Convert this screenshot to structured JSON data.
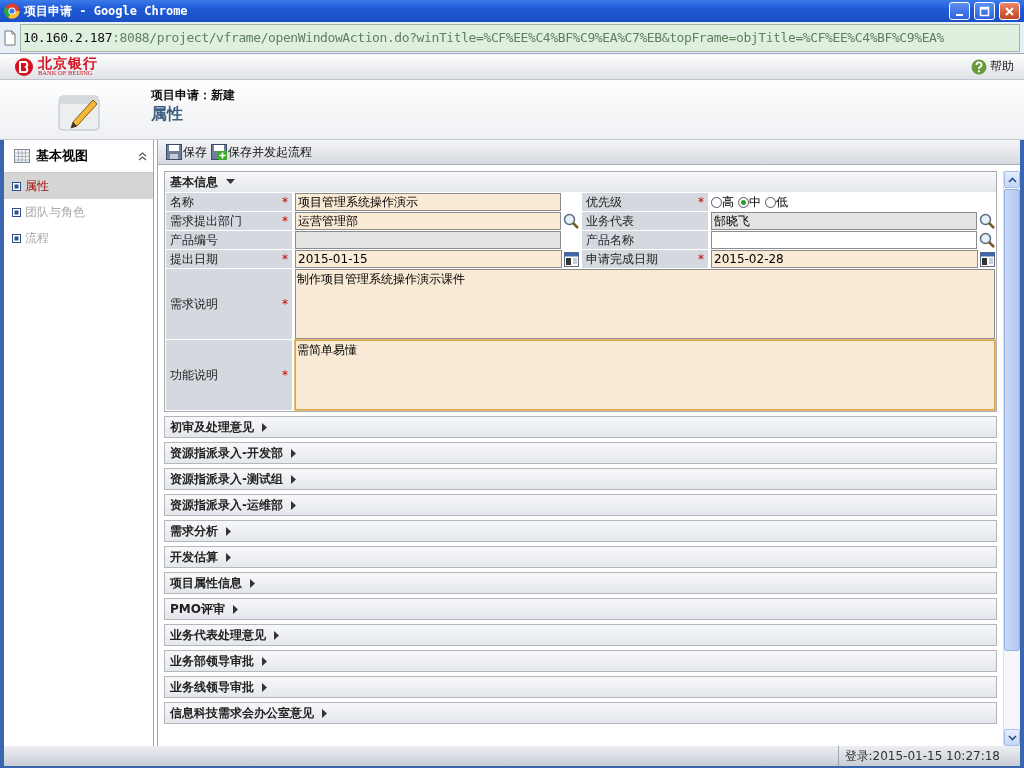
{
  "window": {
    "title": "项目申请 - Google Chrome"
  },
  "address": {
    "host": "10.160.2.187",
    "rest": ":8088/project/vframe/openWindowAction.do?winTitle=%CF%EE%C4%BF%C9%EA%C7%EB&topFrame=objTitle=%CF%EE%C4%BF%C9%EA%"
  },
  "brand": {
    "name": "北京银行",
    "subtitle": "BANK OF BEIJING",
    "help": "帮助"
  },
  "page_header": {
    "title": "项目申请：新建",
    "subtitle": "属性"
  },
  "sidebar": {
    "title": "基本视图",
    "items": [
      {
        "label": "属性",
        "selected": true,
        "disabled": false
      },
      {
        "label": "团队与角色",
        "selected": false,
        "disabled": true
      },
      {
        "label": "流程",
        "selected": false,
        "disabled": true
      }
    ]
  },
  "toolbar": [
    {
      "kind": "save",
      "label": "保存"
    },
    {
      "kind": "save-start",
      "label": "保存并发起流程"
    }
  ],
  "sections": [
    {
      "title": "基本信息",
      "expanded": true,
      "fields": [
        {
          "kind": "text",
          "label": "名称",
          "required_mark": "*",
          "readonly": false,
          "value": "项目管理系统操作演示"
        },
        {
          "kind": "radio",
          "label": "优先级",
          "required_mark": "*",
          "options": [
            {
              "label": "高",
              "selected": false
            },
            {
              "label": "中",
              "selected": true
            },
            {
              "label": "低",
              "selected": false
            }
          ]
        },
        {
          "kind": "lookup",
          "label": "需求提出部门",
          "required_mark": "*",
          "readonly": false,
          "value": "运营管理部"
        },
        {
          "kind": "lookup",
          "label": "业务代表",
          "readonly": true,
          "value": "郜晓飞"
        },
        {
          "kind": "text",
          "label": "产品编号",
          "readonly": true
        },
        {
          "kind": "lookup",
          "label": "产品名称",
          "readonly": false
        },
        {
          "kind": "date",
          "label": "提出日期",
          "required_mark": "*",
          "readonly": false,
          "value": "2015-01-15"
        },
        {
          "kind": "date",
          "label": "申请完成日期",
          "required_mark": "*",
          "readonly": false,
          "value": "2015-02-28"
        },
        {
          "kind": "textarea",
          "label": "需求说明",
          "required_mark": "*",
          "focused": false,
          "value": "制作项目管理系统操作演示课件"
        },
        {
          "kind": "textarea",
          "label": "功能说明",
          "required_mark": "*",
          "focused": true,
          "value": "需简单易懂"
        }
      ]
    },
    {
      "title": "初审及处理意见",
      "expanded": false
    },
    {
      "title": "资源指派录入-开发部",
      "expanded": false
    },
    {
      "title": "资源指派录入-测试组",
      "expanded": false
    },
    {
      "title": "资源指派录入-运维部",
      "expanded": false
    },
    {
      "title": "需求分析",
      "expanded": false
    },
    {
      "title": "开发估算",
      "expanded": false
    },
    {
      "title": "项目属性信息",
      "expanded": false
    },
    {
      "title": "PMO评审",
      "expanded": false
    },
    {
      "title": "业务代表处理意见",
      "expanded": false
    },
    {
      "title": "业务部领导审批",
      "expanded": false
    },
    {
      "title": "业务线领导审批",
      "expanded": false
    },
    {
      "title": "信息科技需求会办公室意见",
      "expanded": false
    }
  ],
  "status_bar": {
    "login": "登录:2015-01-15 10:27:18"
  }
}
